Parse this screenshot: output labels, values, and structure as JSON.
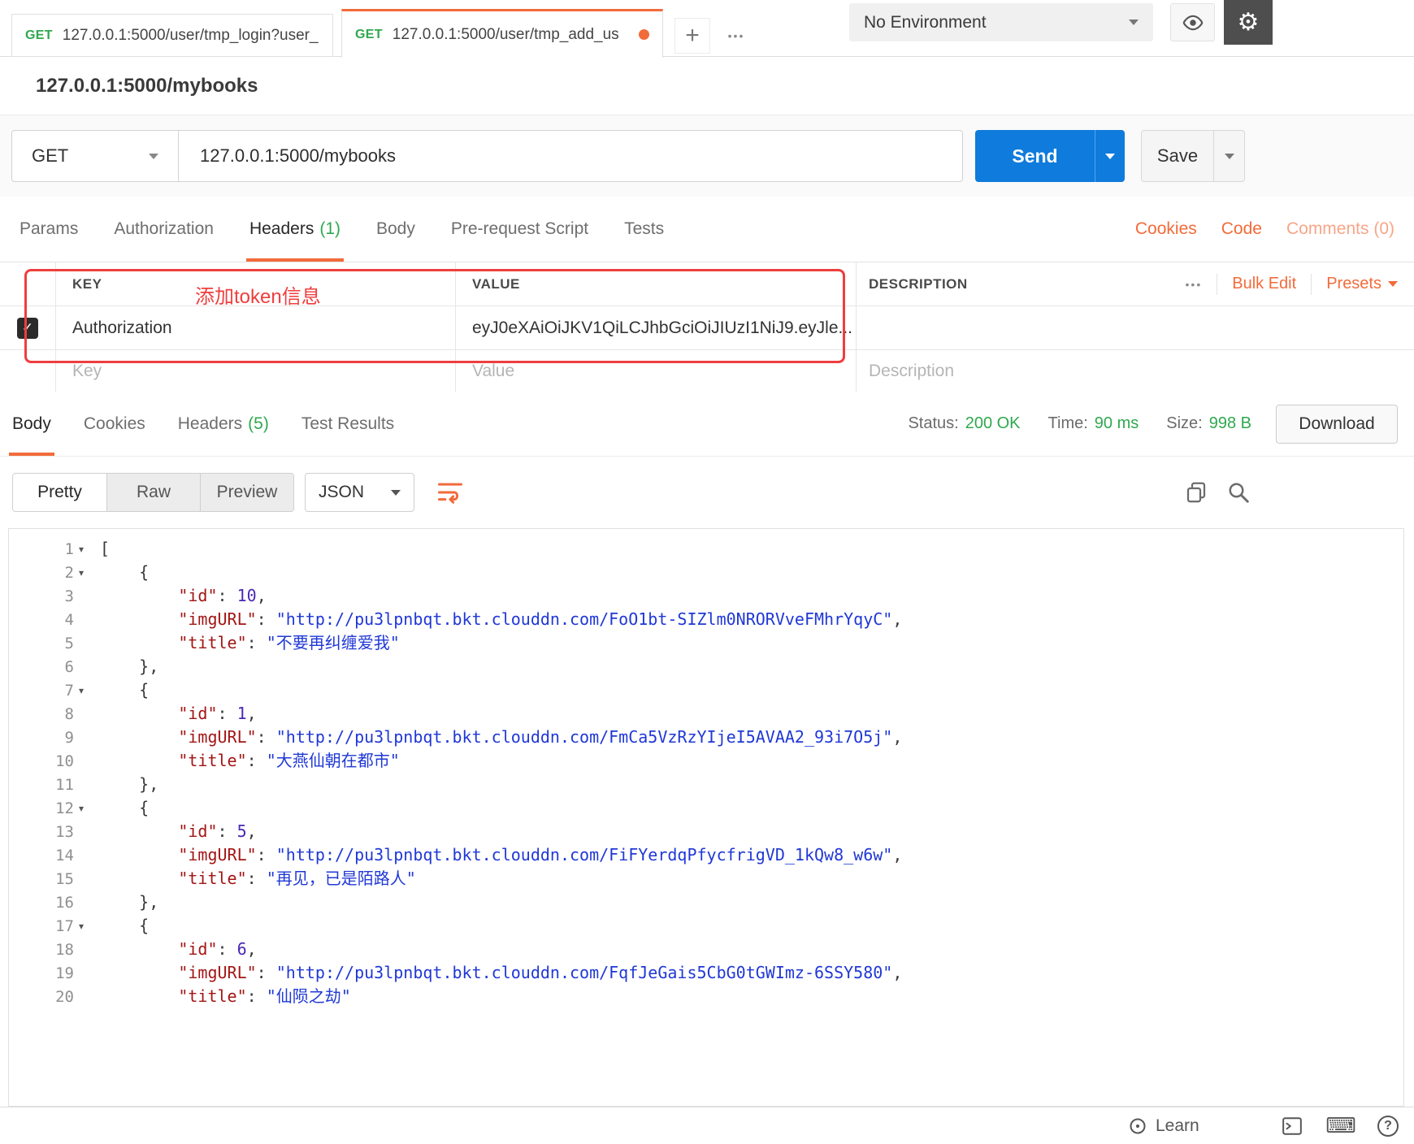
{
  "icons": {
    "check": "✓",
    "dots": "•••",
    "plus": "+",
    "gear": "⚙",
    "keyboard": "⌨",
    "help": "?"
  },
  "topbar": {
    "tabs": [
      {
        "method": "GET",
        "title": "127.0.0.1:5000/user/tmp_login?user_"
      },
      {
        "method": "GET",
        "title": "127.0.0.1:5000/user/tmp_add_us"
      }
    ],
    "environment": "No Environment"
  },
  "request": {
    "name": "127.0.0.1:5000/mybooks",
    "method": "GET",
    "url": "127.0.0.1:5000/mybooks",
    "send": "Send",
    "save": "Save"
  },
  "request_tabs": {
    "params": "Params",
    "authorization": "Authorization",
    "headers_label": "Headers",
    "headers_count": "(1)",
    "body": "Body",
    "prerequest": "Pre-request Script",
    "tests": "Tests",
    "cookies": "Cookies",
    "code": "Code",
    "comments": "Comments (0)"
  },
  "headers_editor": {
    "annotation": "添加token信息",
    "col_key": "KEY",
    "col_value": "VALUE",
    "col_description": "DESCRIPTION",
    "bulk_edit": "Bulk Edit",
    "presets": "Presets",
    "rows": [
      {
        "key": "Authorization",
        "value": "eyJ0eXAiOiJKV1QiLCJhbGciOiJIUzI1NiJ9.eyJle..."
      }
    ],
    "placeholder_key": "Key",
    "placeholder_value": "Value",
    "placeholder_description": "Description"
  },
  "response": {
    "tabs": {
      "body": "Body",
      "cookies": "Cookies",
      "headers_label": "Headers",
      "headers_count": "(5)",
      "test_results": "Test Results"
    },
    "meta": {
      "status_label": "Status:",
      "status_value": "200 OK",
      "time_label": "Time:",
      "time_value": "90 ms",
      "size_label": "Size:",
      "size_value": "998 B",
      "download": "Download"
    },
    "viewer": {
      "pretty": "Pretty",
      "raw": "Raw",
      "preview": "Preview",
      "format": "JSON"
    }
  },
  "response_lines": [
    {
      "n": "1",
      "fold": true,
      "seg": [
        {
          "c": "p",
          "t": "["
        }
      ]
    },
    {
      "n": "2",
      "fold": true,
      "seg": [
        {
          "c": "p",
          "t": "    {"
        }
      ]
    },
    {
      "n": "3",
      "fold": false,
      "seg": [
        {
          "c": "p",
          "t": "        "
        },
        {
          "c": "k",
          "t": "\"id\""
        },
        {
          "c": "p",
          "t": ": "
        },
        {
          "c": "n",
          "t": "10"
        },
        {
          "c": "p",
          "t": ","
        }
      ]
    },
    {
      "n": "4",
      "fold": false,
      "seg": [
        {
          "c": "p",
          "t": "        "
        },
        {
          "c": "k",
          "t": "\"imgURL\""
        },
        {
          "c": "p",
          "t": ": "
        },
        {
          "c": "s",
          "t": "\"http://pu3lpnbqt.bkt.clouddn.com/FoO1bt-SIZlm0NRORVveFMhrYqyC\""
        },
        {
          "c": "p",
          "t": ","
        }
      ]
    },
    {
      "n": "5",
      "fold": false,
      "seg": [
        {
          "c": "p",
          "t": "        "
        },
        {
          "c": "k",
          "t": "\"title\""
        },
        {
          "c": "p",
          "t": ": "
        },
        {
          "c": "s",
          "t": "\"不要再纠缠爱我\""
        }
      ]
    },
    {
      "n": "6",
      "fold": false,
      "seg": [
        {
          "c": "p",
          "t": "    },"
        }
      ]
    },
    {
      "n": "7",
      "fold": true,
      "seg": [
        {
          "c": "p",
          "t": "    {"
        }
      ]
    },
    {
      "n": "8",
      "fold": false,
      "seg": [
        {
          "c": "p",
          "t": "        "
        },
        {
          "c": "k",
          "t": "\"id\""
        },
        {
          "c": "p",
          "t": ": "
        },
        {
          "c": "n",
          "t": "1"
        },
        {
          "c": "p",
          "t": ","
        }
      ]
    },
    {
      "n": "9",
      "fold": false,
      "seg": [
        {
          "c": "p",
          "t": "        "
        },
        {
          "c": "k",
          "t": "\"imgURL\""
        },
        {
          "c": "p",
          "t": ": "
        },
        {
          "c": "s",
          "t": "\"http://pu3lpnbqt.bkt.clouddn.com/FmCa5VzRzYIjeI5AVAA2_93i7O5j\""
        },
        {
          "c": "p",
          "t": ","
        }
      ]
    },
    {
      "n": "10",
      "fold": false,
      "seg": [
        {
          "c": "p",
          "t": "        "
        },
        {
          "c": "k",
          "t": "\"title\""
        },
        {
          "c": "p",
          "t": ": "
        },
        {
          "c": "s",
          "t": "\"大燕仙朝在都市\""
        }
      ]
    },
    {
      "n": "11",
      "fold": false,
      "seg": [
        {
          "c": "p",
          "t": "    },"
        }
      ]
    },
    {
      "n": "12",
      "fold": true,
      "seg": [
        {
          "c": "p",
          "t": "    {"
        }
      ]
    },
    {
      "n": "13",
      "fold": false,
      "seg": [
        {
          "c": "p",
          "t": "        "
        },
        {
          "c": "k",
          "t": "\"id\""
        },
        {
          "c": "p",
          "t": ": "
        },
        {
          "c": "n",
          "t": "5"
        },
        {
          "c": "p",
          "t": ","
        }
      ]
    },
    {
      "n": "14",
      "fold": false,
      "seg": [
        {
          "c": "p",
          "t": "        "
        },
        {
          "c": "k",
          "t": "\"imgURL\""
        },
        {
          "c": "p",
          "t": ": "
        },
        {
          "c": "s",
          "t": "\"http://pu3lpnbqt.bkt.clouddn.com/FiFYerdqPfycfrigVD_1kQw8_w6w\""
        },
        {
          "c": "p",
          "t": ","
        }
      ]
    },
    {
      "n": "15",
      "fold": false,
      "seg": [
        {
          "c": "p",
          "t": "        "
        },
        {
          "c": "k",
          "t": "\"title\""
        },
        {
          "c": "p",
          "t": ": "
        },
        {
          "c": "s",
          "t": "\"再见，已是陌路人\""
        }
      ]
    },
    {
      "n": "16",
      "fold": false,
      "seg": [
        {
          "c": "p",
          "t": "    },"
        }
      ]
    },
    {
      "n": "17",
      "fold": true,
      "seg": [
        {
          "c": "p",
          "t": "    {"
        }
      ]
    },
    {
      "n": "18",
      "fold": false,
      "seg": [
        {
          "c": "p",
          "t": "        "
        },
        {
          "c": "k",
          "t": "\"id\""
        },
        {
          "c": "p",
          "t": ": "
        },
        {
          "c": "n",
          "t": "6"
        },
        {
          "c": "p",
          "t": ","
        }
      ]
    },
    {
      "n": "19",
      "fold": false,
      "seg": [
        {
          "c": "p",
          "t": "        "
        },
        {
          "c": "k",
          "t": "\"imgURL\""
        },
        {
          "c": "p",
          "t": ": "
        },
        {
          "c": "s",
          "t": "\"http://pu3lpnbqt.bkt.clouddn.com/FqfJeGais5CbG0tGWImz-6SSY580\""
        },
        {
          "c": "p",
          "t": ","
        }
      ]
    },
    {
      "n": "20",
      "fold": false,
      "seg": [
        {
          "c": "p",
          "t": "        "
        },
        {
          "c": "k",
          "t": "\"title\""
        },
        {
          "c": "p",
          "t": ": "
        },
        {
          "c": "s",
          "t": "\"仙陨之劫\""
        }
      ]
    }
  ],
  "statusbar": {
    "learn": "Learn"
  }
}
